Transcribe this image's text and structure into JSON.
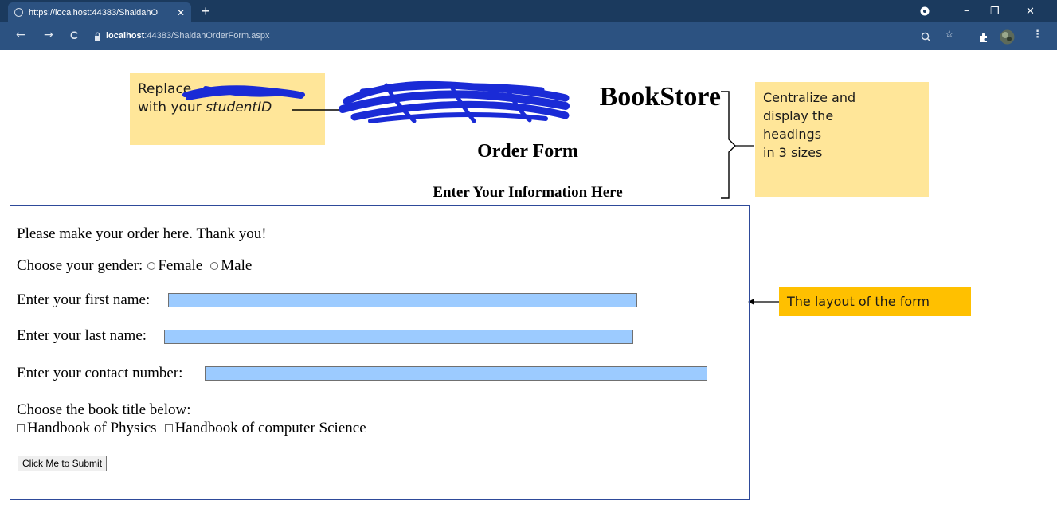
{
  "browser": {
    "tab_title": "https://localhost:44383/ShaidahO",
    "tab_close": "✕",
    "new_tab": "+",
    "url_host": "localhost",
    "url_rest": ":44383/ShaidahOrderForm.aspx",
    "back": "←",
    "forward": "→",
    "reload": "C",
    "lock": "🔒",
    "minimize": "−",
    "maximize": "❐",
    "close": "✕",
    "menu": "⋮"
  },
  "headings": {
    "store": "BookStore",
    "form": "Order Form",
    "info": "Enter Your Information Here"
  },
  "notes": {
    "left_line1": "Replace",
    "left_line2_a": "with your ",
    "left_line2_b": "studentID",
    "right_l1": "Centralize and",
    "right_l2": "display the",
    "right_l3": "headings",
    "right_l4": "in 3 sizes",
    "layout": "The layout of the form"
  },
  "form": {
    "intro": "Please make your order here. Thank you!",
    "gender_label": "Choose your gender:",
    "gender_options": [
      "Female",
      "Male"
    ],
    "first_name_label": "Enter your first name:",
    "first_name_value": "",
    "last_name_label": "Enter your last name:",
    "last_name_value": "",
    "contact_label": "Enter your contact number:",
    "contact_value": "",
    "book_label": "Choose the book title below:",
    "books": [
      "Handbook of Physics",
      "Handbook of computer Science"
    ],
    "submit_label": "Click Me to Submit"
  },
  "colors": {
    "input_bg": "#9ccbff",
    "note_yellow": "#ffe699",
    "note_orange": "#ffc000",
    "scribble": "#1a2bd6"
  }
}
